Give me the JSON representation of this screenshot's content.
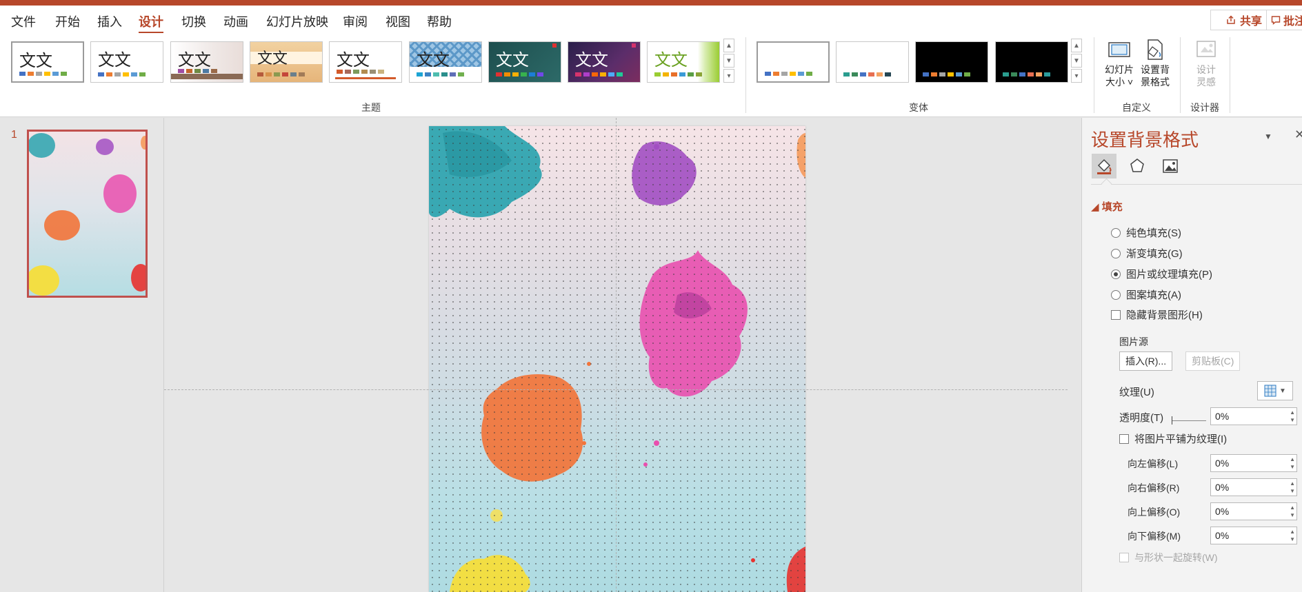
{
  "menu": {
    "items": [
      "文件",
      "开始",
      "插入",
      "设计",
      "切换",
      "动画",
      "幻灯片放映",
      "审阅",
      "视图",
      "帮助"
    ],
    "active": "设计",
    "share_label": "共享",
    "comment_label": "批注"
  },
  "ribbon": {
    "theme_text": "文文",
    "groups": {
      "themes": "主题",
      "variants": "变体",
      "customize": "自定义",
      "designer": "设计器"
    },
    "slide_size": {
      "line1": "幻灯片",
      "line2": "大小 ˅"
    },
    "format_bg": {
      "line1": "设置背",
      "line2": "景格式"
    },
    "design_ideas": {
      "line1": "设计",
      "line2": "灵感"
    }
  },
  "thumbnails": {
    "slide_number": "1"
  },
  "format_pane": {
    "title": "设置背景格式",
    "tabs": [
      "fill-icon",
      "effects-icon",
      "picture-icon"
    ],
    "fill_section": "填充",
    "fill_options": [
      {
        "label": "纯色填充(S)",
        "selected": false
      },
      {
        "label": "渐变填充(G)",
        "selected": false
      },
      {
        "label": "图片或纹理填充(P)",
        "selected": true
      },
      {
        "label": "图案填充(A)",
        "selected": false
      }
    ],
    "hide_bg_graphics": "隐藏背景图形(H)",
    "picture_source": "图片源",
    "insert_button": "插入(R)...",
    "clipboard_button": "剪贴板(C)",
    "texture_label": "纹理(U)",
    "transparency_label": "透明度(T)",
    "transparency_value": "0%",
    "tile_label": "将图片平铺为纹理(I)",
    "offsets": [
      {
        "label": "向左偏移(L)",
        "value": "0%"
      },
      {
        "label": "向右偏移(R)",
        "value": "0%"
      },
      {
        "label": "向上偏移(O)",
        "value": "0%"
      },
      {
        "label": "向下偏移(M)",
        "value": "0%"
      }
    ],
    "rotate_with_shape": "与形状一起旋转(W)"
  },
  "colors": {
    "accent": "#b7472a"
  }
}
